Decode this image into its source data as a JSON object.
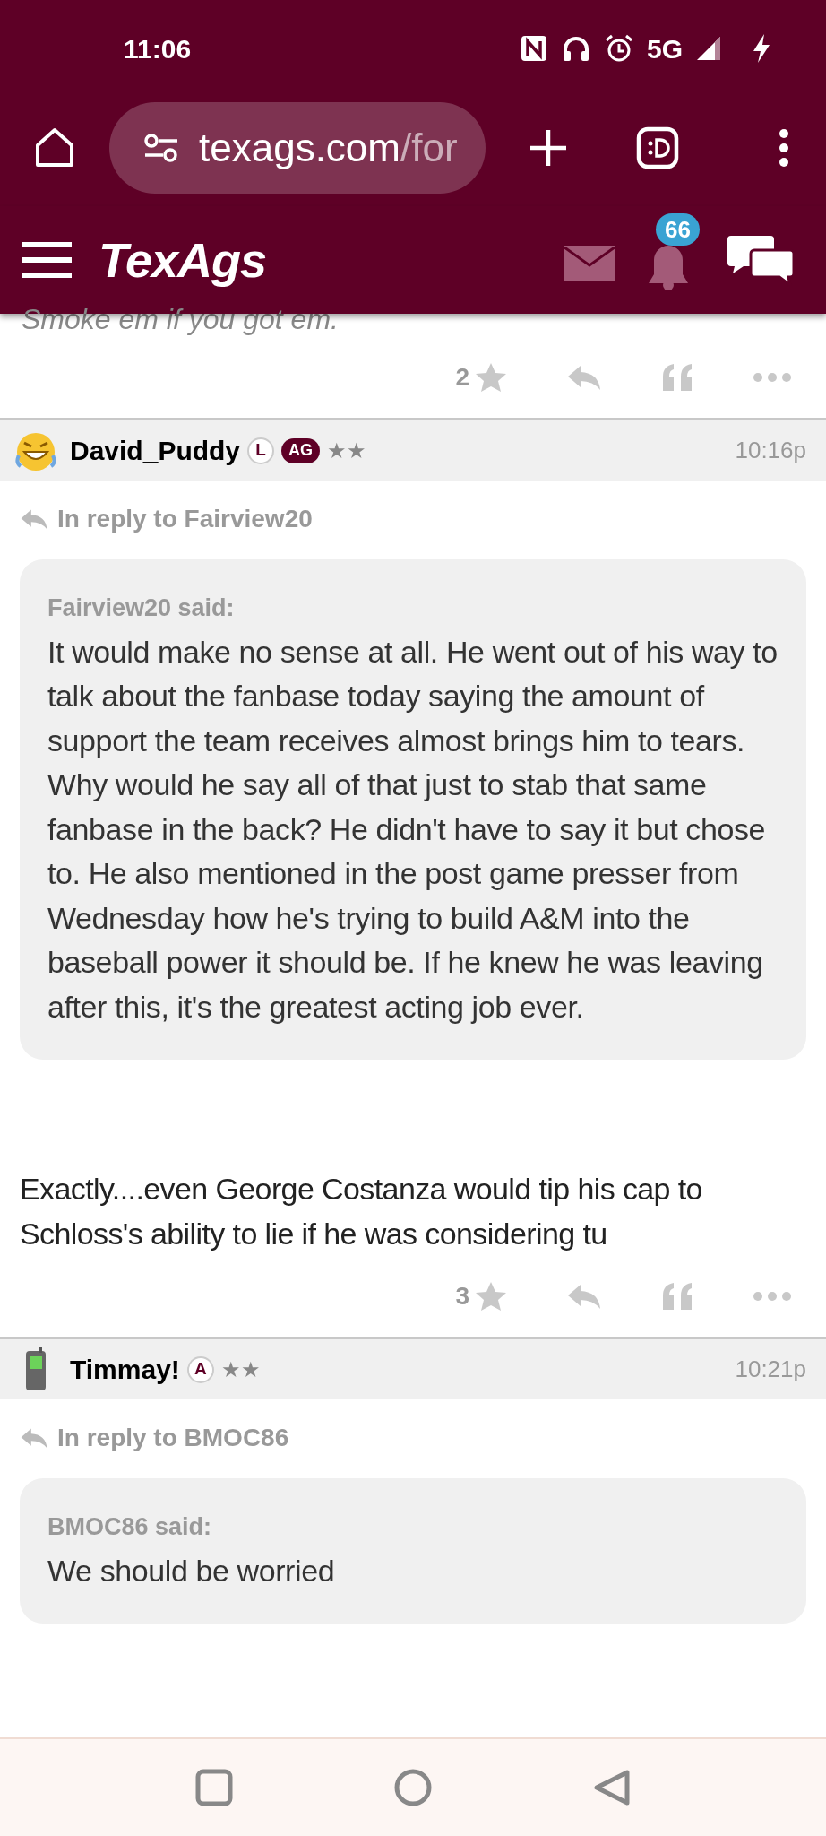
{
  "status_bar": {
    "time": "11:06",
    "network": "5G"
  },
  "browser": {
    "url_host": "texags.com",
    "url_path": "/for"
  },
  "app_header": {
    "logo": "TexAgs",
    "notification_count": "66"
  },
  "posts": [
    {
      "kind": "tail",
      "body": "Smoke em if you got em.",
      "star_count": "2"
    },
    {
      "kind": "post",
      "author": "David_Puddy",
      "badges": [
        {
          "kind": "circle",
          "label": "L"
        },
        {
          "kind": "pill",
          "label": "AG"
        }
      ],
      "rank": "★★",
      "time": "10:16p",
      "reply_to": "In reply to Fairview20",
      "quote": {
        "author_line": "Fairview20 said:",
        "text": "It would make no sense at all. He went out of his way to talk about the fanbase today saying the amount of support the team receives almost brings him to tears. Why would he say all of that just to stab that same fanbase in the back? He didn't have to say it but chose to. He also mentioned in the post game presser from Wednesday how he's trying to build A&M into the baseball power it should be. If he knew he was leaving after this, it's the greatest acting job ever."
      },
      "body": "Exactly....even George Costanza would tip his cap to Schloss's ability to lie if he was considering tu",
      "star_count": "3"
    },
    {
      "kind": "post",
      "author": "Timmay!",
      "badges": [
        {
          "kind": "circle",
          "label": "A"
        }
      ],
      "rank": "★★",
      "time": "10:21p",
      "reply_to": "In reply to BMOC86",
      "quote": {
        "author_line": "BMOC86 said:",
        "text": "We should be worried"
      }
    }
  ]
}
